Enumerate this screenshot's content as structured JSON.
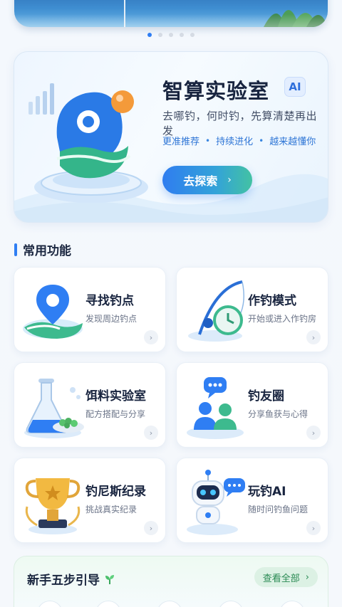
{
  "carousel": {
    "pages": 5,
    "active_index": 0
  },
  "hero": {
    "title": "智算实验室",
    "badge": "AI",
    "subtitle": "去哪钓，何时钓，先算清楚再出发",
    "tags": [
      "更准推荐",
      "持续进化",
      "越来越懂你"
    ],
    "tag_separator": "•",
    "button_label": "去探索",
    "button_chevron": "›"
  },
  "features": {
    "section_title": "常用功能",
    "arrow": "›",
    "items": [
      {
        "title": "寻找钓点",
        "subtitle": "发现周边钓点",
        "icon": "map-pin-icon"
      },
      {
        "title": "作钓模式",
        "subtitle": "开始或进入作钓房",
        "icon": "fishing-rod-clock-icon"
      },
      {
        "title": "饵料实验室",
        "subtitle": "配方搭配与分享",
        "icon": "flask-bait-icon"
      },
      {
        "title": "钓友圈",
        "subtitle": "分享鱼获与心得",
        "icon": "friends-chat-icon"
      },
      {
        "title": "钓尼斯纪录",
        "subtitle": "挑战真实纪录",
        "icon": "trophy-icon"
      },
      {
        "title": "玩钓AI",
        "subtitle": "随时问钓鱼问题",
        "icon": "robot-icon"
      }
    ]
  },
  "guide": {
    "title": "新手五步引导",
    "link_label": "查看全部",
    "link_chevron": "›"
  },
  "colors": {
    "accent": "#2f7ef3",
    "title_text": "#18243f",
    "sub_text": "#6b7488",
    "green": "#43c2a3"
  }
}
